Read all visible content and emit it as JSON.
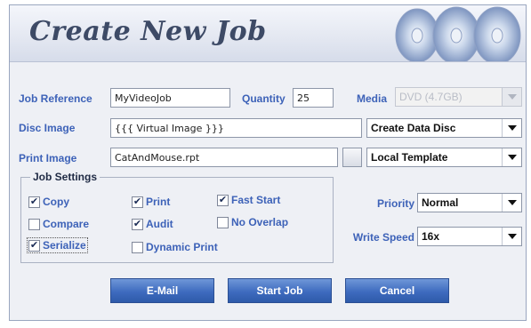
{
  "header": {
    "title": "Create New Job"
  },
  "job_reference": {
    "label": "Job Reference",
    "value": "MyVideoJob"
  },
  "quantity": {
    "label": "Quantity",
    "value": "25"
  },
  "media": {
    "label": "Media",
    "selected": "DVD (4.7GB)"
  },
  "disc_image": {
    "label": "Disc Image",
    "value": "{{{ Virtual Image }}}",
    "mode_selected": "Create Data Disc"
  },
  "print_image": {
    "label": "Print Image",
    "value": "CatAndMouse.rpt",
    "template_selected": "Local Template"
  },
  "job_settings": {
    "title": "Job Settings",
    "options": [
      {
        "label": "Copy",
        "checked": true
      },
      {
        "label": "Print",
        "checked": true
      },
      {
        "label": "Fast Start",
        "checked": true
      },
      {
        "label": "Compare",
        "checked": false
      },
      {
        "label": "Audit",
        "checked": true
      },
      {
        "label": "No Overlap",
        "checked": false
      },
      {
        "label": "Serialize",
        "checked": true
      },
      {
        "label": "Dynamic Print",
        "checked": false
      }
    ]
  },
  "priority": {
    "label": "Priority",
    "selected": "Normal"
  },
  "write_speed": {
    "label": "Write Speed",
    "selected": "16x"
  },
  "buttons": {
    "email": "E-Mail",
    "start_job": "Start Job",
    "cancel": "Cancel"
  },
  "colors": {
    "label": "#3d62b8",
    "button": "#3e6bbf",
    "title": "#3d4a66"
  }
}
